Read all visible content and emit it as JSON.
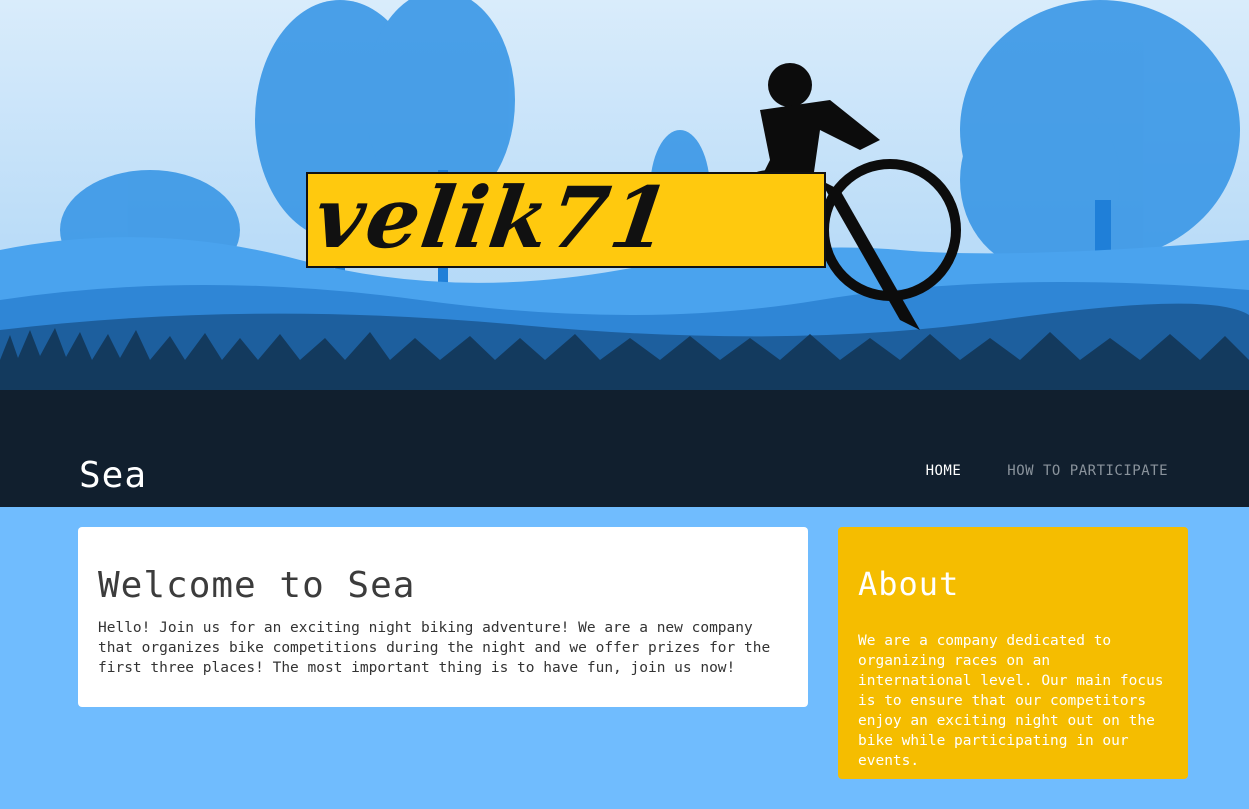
{
  "header": {
    "logo_text": "velik71",
    "site_title": "Sea",
    "nav": [
      {
        "label": "HOME",
        "active": true
      },
      {
        "label": "HOW TO PARTICIPATE",
        "active": false
      }
    ]
  },
  "welcome": {
    "title": "Welcome to Sea",
    "body": "Hello! Join us for an exciting night biking adventure! We are a new company that organizes bike competitions during the night and we offer prizes for the first three places! The most important thing is to have fun, join us now!"
  },
  "about": {
    "title": "About",
    "body": "We are a company dedicated to organizing races on an international level. Our main focus is to ensure that our competitors enjoy an exciting night out on the bike while participating in our events."
  },
  "colors": {
    "page_background": "#70bcfe",
    "hero_dark": "#111f2e",
    "sky": "#cfe8fb",
    "about_card": "#f5bd00",
    "logo_banner": "#ffc90e"
  }
}
